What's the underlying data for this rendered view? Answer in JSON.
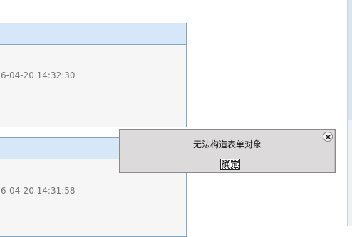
{
  "cards": [
    {
      "timestamp": "6-04-20 14:32:30"
    },
    {
      "timestamp": "6-04-20 14:31:58"
    }
  ],
  "dialog": {
    "message": "无法构造表单对象",
    "ok_label": "确定",
    "close_icon": "close-icon"
  }
}
